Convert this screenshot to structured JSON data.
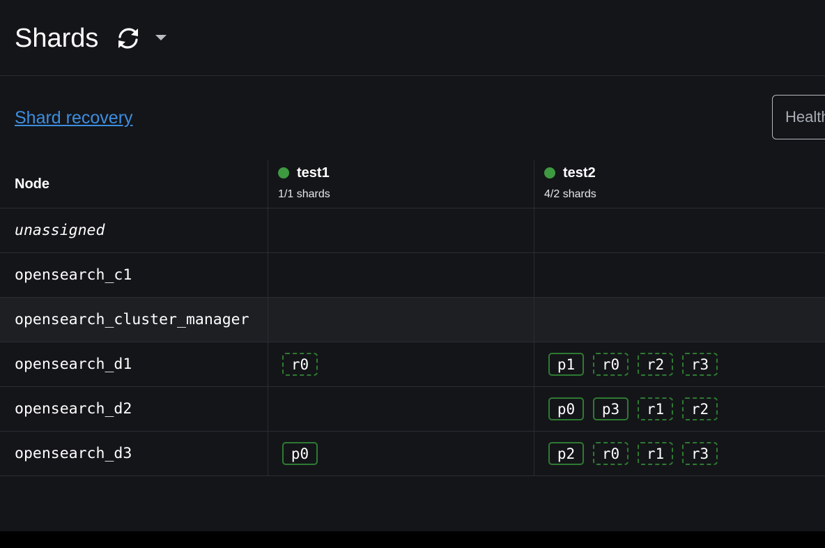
{
  "header": {
    "title": "Shards",
    "refresh_icon": "refresh-icon",
    "dropdown_icon": "caret-down-icon"
  },
  "toolbar": {
    "recovery_link": "Shard recovery",
    "health_filter_value": "Health"
  },
  "colors": {
    "accent_link": "#3d8ee0",
    "health_green": "#3d9a40",
    "shard_border": "#2e7a32",
    "background": "#141519"
  },
  "table": {
    "node_header": "Node",
    "indices": [
      {
        "name": "test1",
        "shards": "1/1 shards",
        "health": "green"
      },
      {
        "name": "test2",
        "shards": "4/2 shards",
        "health": "green"
      }
    ],
    "rows": [
      {
        "node": "unassigned",
        "italic": true,
        "highlight": false,
        "cells": [
          [],
          []
        ]
      },
      {
        "node": "opensearch_c1",
        "italic": false,
        "highlight": false,
        "cells": [
          [],
          []
        ]
      },
      {
        "node": "opensearch_cluster_manager",
        "italic": false,
        "highlight": true,
        "cells": [
          [],
          []
        ]
      },
      {
        "node": "opensearch_d1",
        "italic": false,
        "highlight": false,
        "cells": [
          [
            {
              "label": "r0",
              "kind": "replica"
            }
          ],
          [
            {
              "label": "p1",
              "kind": "primary"
            },
            {
              "label": "r0",
              "kind": "replica"
            },
            {
              "label": "r2",
              "kind": "replica"
            },
            {
              "label": "r3",
              "kind": "replica"
            }
          ]
        ]
      },
      {
        "node": "opensearch_d2",
        "italic": false,
        "highlight": false,
        "cells": [
          [],
          [
            {
              "label": "p0",
              "kind": "primary"
            },
            {
              "label": "p3",
              "kind": "primary"
            },
            {
              "label": "r1",
              "kind": "replica"
            },
            {
              "label": "r2",
              "kind": "replica"
            }
          ]
        ]
      },
      {
        "node": "opensearch_d3",
        "italic": false,
        "highlight": false,
        "cells": [
          [
            {
              "label": "p0",
              "kind": "primary"
            }
          ],
          [
            {
              "label": "p2",
              "kind": "primary"
            },
            {
              "label": "r0",
              "kind": "replica"
            },
            {
              "label": "r1",
              "kind": "replica"
            },
            {
              "label": "r3",
              "kind": "replica"
            }
          ]
        ]
      }
    ]
  }
}
